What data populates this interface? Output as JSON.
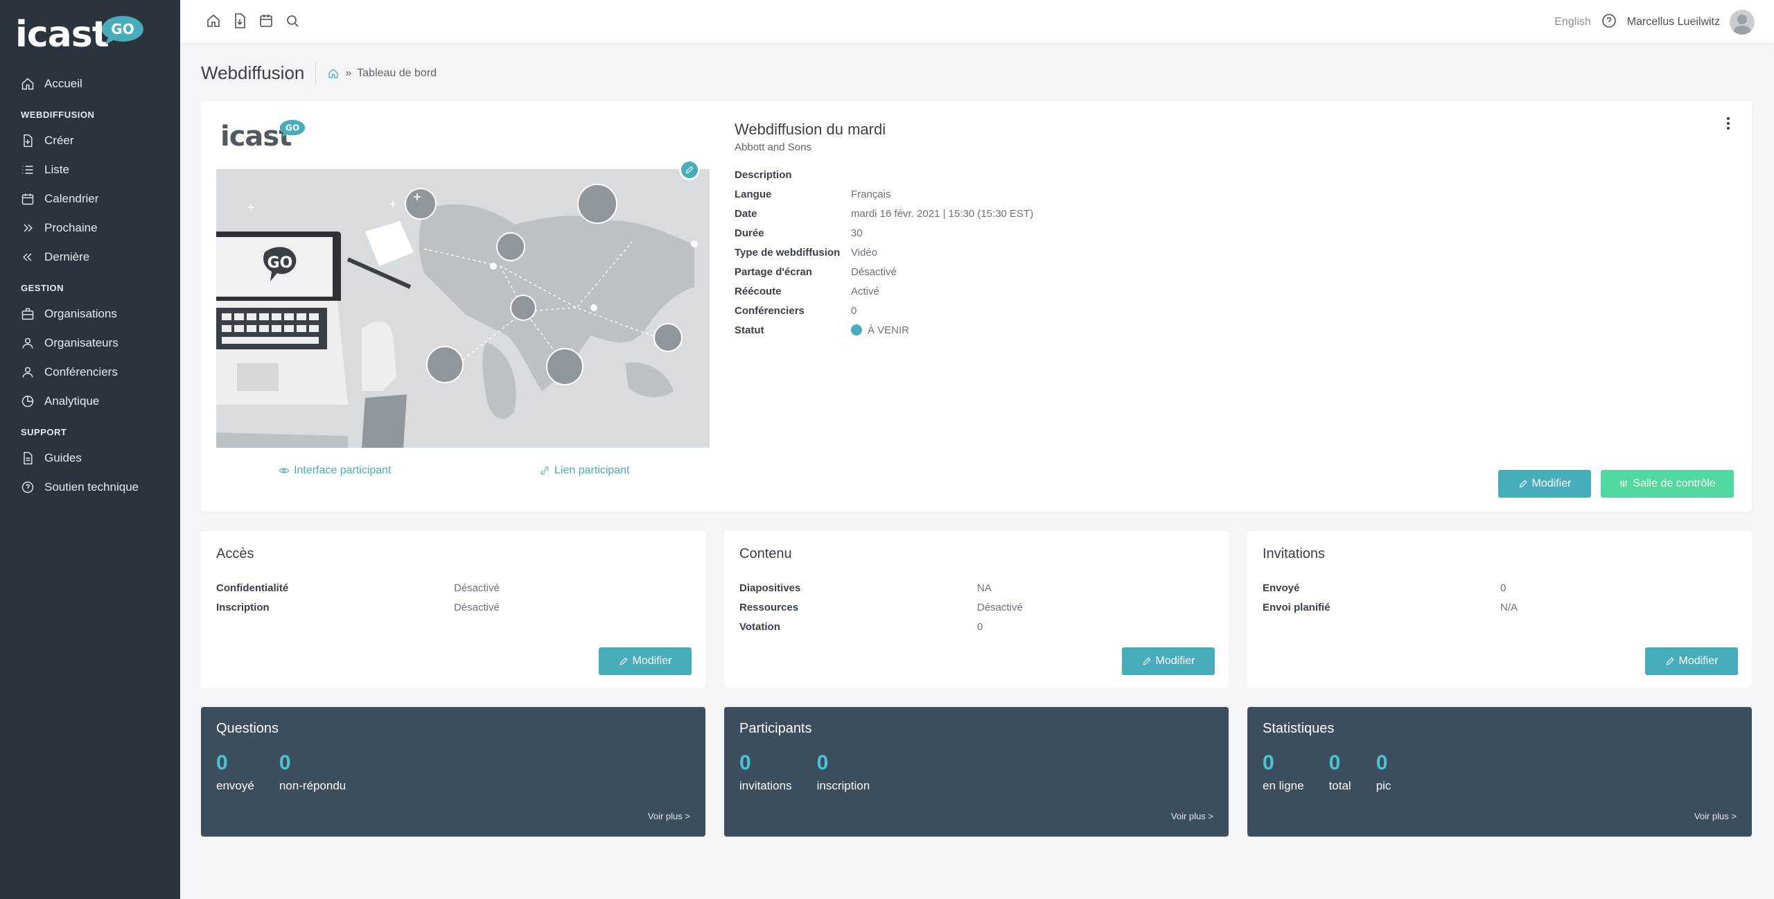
{
  "brand": {
    "logo_text": "icast",
    "badge_text": "GO",
    "accent": "#47adba",
    "green": "#51d7a0",
    "sidebar_bg": "#2b333c",
    "stat_bg": "#3c4d5e"
  },
  "sidebar": {
    "home": "Accueil",
    "sections": [
      {
        "title": "WEBDIFFUSION",
        "items": [
          {
            "label": "Créer",
            "icon": "file-plus-icon"
          },
          {
            "label": "Liste",
            "icon": "list-icon"
          },
          {
            "label": "Calendrier",
            "icon": "calendar-icon"
          },
          {
            "label": "Prochaine",
            "icon": "chevrons-right-icon"
          },
          {
            "label": "Dernière",
            "icon": "chevrons-left-icon"
          }
        ]
      },
      {
        "title": "GESTION",
        "items": [
          {
            "label": "Organisations",
            "icon": "building-icon"
          },
          {
            "label": "Organisateurs",
            "icon": "user-icon"
          },
          {
            "label": "Conférenciers",
            "icon": "user-icon"
          },
          {
            "label": "Analytique",
            "icon": "pie-icon"
          }
        ]
      },
      {
        "title": "SUPPORT",
        "items": [
          {
            "label": "Guides",
            "icon": "doc-icon"
          },
          {
            "label": "Soutien technique",
            "icon": "help-icon"
          }
        ]
      }
    ]
  },
  "topbar": {
    "language": "English",
    "user_name": "Marcellus Lueilwitz"
  },
  "header": {
    "title": "Webdiffusion",
    "breadcrumb": "Tableau de bord"
  },
  "webcast": {
    "title": "Webdiffusion du mardi",
    "organization": "Abbott and Sons",
    "props": [
      {
        "k": "Description",
        "v": ""
      },
      {
        "k": "Langue",
        "v": "Français"
      },
      {
        "k": "Date",
        "v": "mardi 16 févr. 2021 | 15:30 (15:30 EST)"
      },
      {
        "k": "Durée",
        "v": "30"
      },
      {
        "k": "Type de webdiffusion",
        "v": "Vidéo"
      },
      {
        "k": "Partage d'écran",
        "v": "Désactivé"
      },
      {
        "k": "Réécoute",
        "v": "Activé"
      },
      {
        "k": "Conférenciers",
        "v": "0"
      },
      {
        "k": "Statut",
        "v": "À VENIR"
      }
    ],
    "participant_interface": "Interface participant",
    "participant_link": "Lien participant",
    "edit_label": "Modifier",
    "control_room_label": "Salle de contrôle"
  },
  "cards": {
    "acces": {
      "title": "Accès",
      "rows": [
        {
          "k": "Confidentialité",
          "v": "Désactivé"
        },
        {
          "k": "Inscription",
          "v": "Désactivé"
        }
      ],
      "button": "Modifier"
    },
    "contenu": {
      "title": "Contenu",
      "rows": [
        {
          "k": "Diapositives",
          "v": "NA"
        },
        {
          "k": "Ressources",
          "v": "Désactivé"
        },
        {
          "k": "Votation",
          "v": "0"
        }
      ],
      "button": "Modifier"
    },
    "invitations": {
      "title": "Invitations",
      "rows": [
        {
          "k": "Envoyé",
          "v": "0"
        },
        {
          "k": "Envoi planifié",
          "v": "N/A"
        }
      ],
      "button": "Modifier"
    }
  },
  "stats": {
    "questions": {
      "title": "Questions",
      "items": [
        {
          "n": "0",
          "l": "envoyé"
        },
        {
          "n": "0",
          "l": "non-répondu"
        }
      ],
      "more": "Voir plus >"
    },
    "participants": {
      "title": "Participants",
      "items": [
        {
          "n": "0",
          "l": "invitations"
        },
        {
          "n": "0",
          "l": "inscription"
        }
      ],
      "more": "Voir plus >"
    },
    "statistiques": {
      "title": "Statistiques",
      "items": [
        {
          "n": "0",
          "l": "en ligne"
        },
        {
          "n": "0",
          "l": "total"
        },
        {
          "n": "0",
          "l": "pic"
        }
      ],
      "more": "Voir plus >"
    }
  }
}
